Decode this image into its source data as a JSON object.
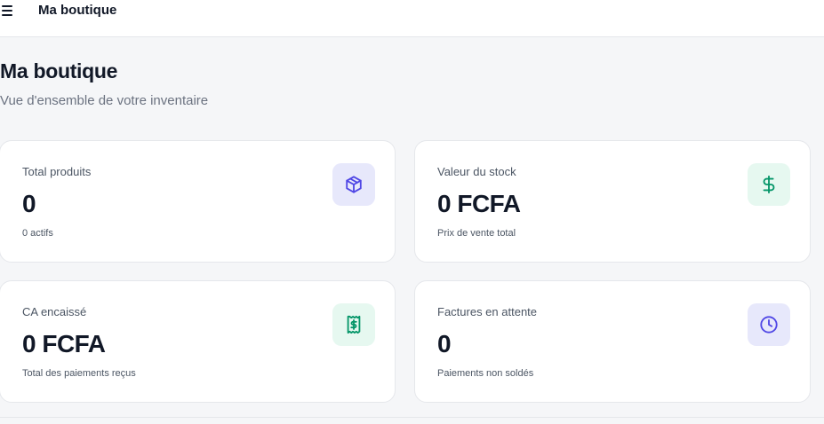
{
  "topbar": {
    "title": "Ma boutique",
    "menu_icon": "hamburger-menu-icon"
  },
  "header": {
    "title": "Ma boutique",
    "subtitle": "Vue d'ensemble de votre inventaire"
  },
  "cards": [
    {
      "label": "Total produits",
      "value": "0",
      "sub": "0 actifs",
      "icon": "package-icon",
      "icon_color": "#4f46e5",
      "icon_bg": "#e7e8fb"
    },
    {
      "label": "Valeur du stock",
      "value": "0 FCFA",
      "sub": "Prix de vente total",
      "icon": "dollar-icon",
      "icon_color": "#059669",
      "icon_bg": "#e6f8f0"
    },
    {
      "label": "CA encaissé",
      "value": "0 FCFA",
      "sub": "Total des paiements reçus",
      "icon": "receipt-icon",
      "icon_color": "#059669",
      "icon_bg": "#e6f8f0"
    },
    {
      "label": "Factures en attente",
      "value": "0",
      "sub": "Paiements non soldés",
      "icon": "clock-icon",
      "icon_color": "#4f46e5",
      "icon_bg": "#e7e8fb"
    }
  ]
}
